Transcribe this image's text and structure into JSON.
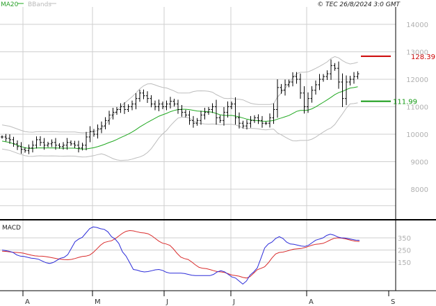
{
  "copyright": "© TEC 26/8/2024 3:0 GMT",
  "legend": {
    "ma": "MA20",
    "bands": "BBands"
  },
  "macd_title": "MACD",
  "colors": {
    "price": "#000000",
    "ma": "#1fa81f",
    "bands": "#bdbdbd",
    "macd": "#2b2bd9",
    "signal": "#d92b2b",
    "resistance": "#cc0000",
    "support": "#119911",
    "grid": "#cfcfcf"
  },
  "chart_data": [
    {
      "type": "line",
      "panel": "price",
      "y_axis": {
        "ticks": [
          "14000",
          "13000",
          "12000",
          "11000",
          "10000",
          "9000",
          "8000"
        ],
        "tick_values": [
          140,
          130,
          120,
          110,
          100,
          90,
          80
        ]
      },
      "x_axis": {
        "labels": [
          "A",
          "M",
          "J",
          "J",
          "A",
          "S"
        ]
      },
      "levels": [
        {
          "name": "resistance",
          "value": 128.39,
          "label": "128.39"
        },
        {
          "name": "support",
          "value": 111.99,
          "label": "111.99"
        }
      ],
      "series": [
        {
          "name": "MA20",
          "role": "moving-average"
        },
        {
          "name": "BBands",
          "role": "bollinger-bands"
        }
      ],
      "close": [
        99,
        98.5,
        98,
        96.5,
        95.5,
        94.5,
        94,
        95,
        96,
        98,
        97,
        96,
        96.5,
        97,
        96,
        95.5,
        96,
        97,
        96.5,
        96,
        95,
        96,
        99,
        101,
        100,
        102,
        103,
        105,
        107,
        108,
        109,
        110,
        109,
        110,
        111,
        113,
        115,
        114,
        113,
        111,
        110,
        111,
        110,
        111,
        112,
        111,
        109,
        108,
        107,
        105,
        104,
        105,
        107,
        108,
        109,
        110,
        106,
        105,
        108,
        110,
        111,
        106,
        104,
        103,
        104,
        105,
        106,
        105,
        104,
        104,
        106,
        109,
        117,
        116,
        118,
        119,
        121,
        120,
        115,
        110,
        113,
        116,
        118,
        120,
        121,
        122,
        125,
        124,
        119,
        113,
        119,
        120,
        121,
        122
      ],
      "ma20_endpoints": {
        "start": 92.5,
        "end": 119.5
      },
      "upper_band_endpoints": {
        "start": 100,
        "end": 126
      },
      "lower_band_endpoints": {
        "start": 89,
        "end": 112
      }
    },
    {
      "type": "line",
      "panel": "macd",
      "y_axis": {
        "ticks": [
          "350",
          "250",
          "150"
        ],
        "tick_values": [
          350,
          250,
          150
        ]
      },
      "series": [
        {
          "name": "MACD",
          "role": "macd"
        },
        {
          "name": "signal",
          "role": "signal"
        }
      ],
      "macd_keypoints": [
        [
          0,
          250
        ],
        [
          4,
          240
        ],
        [
          10,
          200
        ],
        [
          18,
          180
        ],
        [
          26,
          140
        ],
        [
          34,
          190
        ],
        [
          42,
          340
        ],
        [
          50,
          440
        ],
        [
          56,
          420
        ],
        [
          62,
          340
        ],
        [
          68,
          200
        ],
        [
          72,
          90
        ],
        [
          78,
          70
        ],
        [
          86,
          90
        ],
        [
          92,
          60
        ],
        [
          98,
          60
        ],
        [
          106,
          40
        ],
        [
          114,
          40
        ],
        [
          120,
          80
        ],
        [
          128,
          20
        ],
        [
          132,
          -30
        ],
        [
          138,
          70
        ],
        [
          146,
          300
        ],
        [
          152,
          360
        ],
        [
          158,
          300
        ],
        [
          166,
          280
        ],
        [
          174,
          340
        ],
        [
          180,
          380
        ],
        [
          186,
          350
        ],
        [
          196,
          330
        ]
      ],
      "signal_keypoints": [
        [
          0,
          240
        ],
        [
          8,
          230
        ],
        [
          20,
          200
        ],
        [
          36,
          170
        ],
        [
          46,
          200
        ],
        [
          58,
          320
        ],
        [
          70,
          410
        ],
        [
          78,
          390
        ],
        [
          90,
          300
        ],
        [
          100,
          180
        ],
        [
          110,
          100
        ],
        [
          120,
          70
        ],
        [
          128,
          40
        ],
        [
          134,
          20
        ],
        [
          142,
          100
        ],
        [
          152,
          230
        ],
        [
          162,
          260
        ],
        [
          174,
          300
        ],
        [
          184,
          350
        ],
        [
          196,
          320
        ]
      ]
    }
  ]
}
